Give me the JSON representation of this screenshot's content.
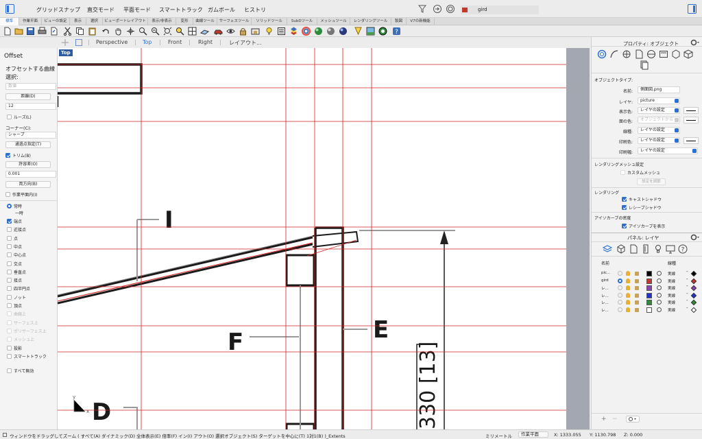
{
  "menubar": {
    "items": [
      "グリッドスナップ",
      "直交モード",
      "平面モード",
      "スマートトラック",
      "ガムボール",
      "ヒストリ"
    ],
    "current_layer": "gird",
    "current_layer_color": "#c0392b"
  },
  "tabs": [
    "標準",
    "作業平面",
    "ビューの設定",
    "表示",
    "選択",
    "ビューポートレイアウト",
    "表示/非表示",
    "変形",
    "曲線ツール",
    "サーフェスツール",
    "ソリッドツール",
    "SubDツール",
    "メッシュツール",
    "レンダリングツール",
    "製図",
    "V7の新機能"
  ],
  "command_panel": {
    "title": "Offset",
    "prompt": "オフセットする曲線",
    "select": "選択:",
    "placeholder": "数値",
    "distance_btn": "距離(D)",
    "distance_value": "12",
    "loose": "ルーズ(L)",
    "corner_label": "コーナー(C):",
    "corner_value": "シャープ",
    "through_btn": "通過点指定(T)",
    "trim": "トリム(B)",
    "tolerance_btn": "許容差(O)",
    "tolerance_value": "0.001",
    "both_btn": "両方向(B)",
    "cplane": "作業平面内(I)",
    "snap_permanent": "常時",
    "snap_once": "一時",
    "snaps": [
      {
        "label": "端点",
        "checked": true,
        "disabled": false
      },
      {
        "label": "近接点",
        "checked": false,
        "disabled": false
      },
      {
        "label": "点",
        "checked": false,
        "disabled": false
      },
      {
        "label": "中点",
        "checked": false,
        "disabled": false
      },
      {
        "label": "中心点",
        "checked": false,
        "disabled": false
      },
      {
        "label": "交点",
        "checked": false,
        "disabled": false
      },
      {
        "label": "垂直点",
        "checked": false,
        "disabled": false
      },
      {
        "label": "接点",
        "checked": false,
        "disabled": false
      },
      {
        "label": "四半円点",
        "checked": false,
        "disabled": false
      },
      {
        "label": "ノット",
        "checked": false,
        "disabled": false
      },
      {
        "label": "頂点",
        "checked": false,
        "disabled": false
      },
      {
        "label": "曲線上",
        "checked": false,
        "disabled": true
      },
      {
        "label": "サーフェス上",
        "checked": false,
        "disabled": true
      },
      {
        "label": "ポリサーフェス上",
        "checked": false,
        "disabled": true
      },
      {
        "label": "メッシュ上",
        "checked": false,
        "disabled": true
      },
      {
        "label": "投影",
        "checked": false,
        "disabled": false
      },
      {
        "label": "スマートトラック",
        "checked": false,
        "disabled": false
      }
    ],
    "disable_all": "すべて無効"
  },
  "viewport": {
    "tabs": [
      "Perspective",
      "Top",
      "Front",
      "Right",
      "レイアウト..."
    ],
    "active": "Top",
    "label": "Top",
    "drawing_labels": {
      "i": "I",
      "f": "F",
      "e": "E",
      "d": "D",
      "dim": "330 [13]"
    },
    "axis_x": "x",
    "axis_y": "y"
  },
  "properties": {
    "header": "プロパティ: オブジェクト",
    "object_type": "オブジェクトタイプ:",
    "name_label": "名前:",
    "name_value": "側面図.png",
    "layer_label": "レイヤ:",
    "layer_value": "picture",
    "display_color_label": "表示色:",
    "display_color_value": "レイヤの設定",
    "material_label": "面の色:",
    "material_value": "オブジェクトから",
    "linetype_label": "線種:",
    "linetype_value": "レイヤの設定",
    "print_color_label": "印刷色:",
    "print_color_value": "レイヤの設定",
    "print_width_label": "印刷幅:",
    "print_width_value": "レイヤの設定",
    "render_mesh_title": "レンダリングメッシュ設定",
    "custom_mesh": "カスタムメッシュ",
    "adjust_btn": "設定を調節",
    "rendering_title": "レンダリング",
    "cast_shadows": "キャストシャドウ",
    "receive_shadows": "レシーブシャドウ",
    "isocurve_title": "アイソカーブの密度",
    "show_isocurves": "アイソカーブを表示"
  },
  "layers": {
    "header": "パネル: レイヤ",
    "col_name": "名前",
    "col_linetype": "線種",
    "rows": [
      {
        "name": "pic...",
        "color": "#000000",
        "linetype": "実線",
        "current": false
      },
      {
        "name": "gird",
        "color": "#c0392b",
        "linetype": "実線",
        "current": true
      },
      {
        "name": "レ...",
        "color": "#8e44ad",
        "linetype": "実線",
        "current": false
      },
      {
        "name": "レ...",
        "color": "#2233cc",
        "linetype": "実線",
        "current": false
      },
      {
        "name": "レ...",
        "color": "#2e8b3a",
        "linetype": "実線",
        "current": false
      },
      {
        "name": "レ...",
        "color": "#ffffff",
        "linetype": "実線",
        "current": false
      }
    ]
  },
  "status": {
    "hint": "ウィンドウをドラッグしてズーム ( すべて(A) ダイナミック(D) 全体表示(E) 倍率(F) イン(I) アウト(O) 選択オブジェクト(S) ターゲットを中心に(T) 1対1(B) )_Extents",
    "units": "ミリメートル",
    "cplane": "作業平面",
    "x": "X: 1333.055",
    "y": "Y: 1130.798",
    "z": "Z: 0.000"
  }
}
